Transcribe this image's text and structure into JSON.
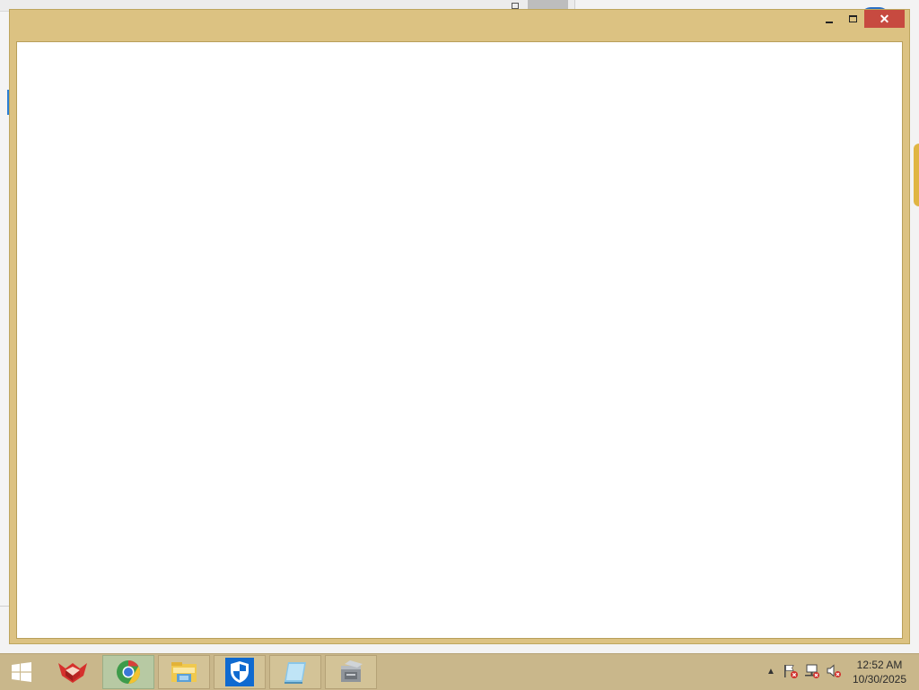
{
  "window": {
    "title": "",
    "buttons": {
      "minimize": "minimize",
      "maximize": "maximize",
      "close": "✕"
    }
  },
  "taskbar": {
    "apps": [
      {
        "name": "red-cube-app-icon",
        "active": false
      },
      {
        "name": "chrome-browser-icon",
        "active": true
      },
      {
        "name": "file-explorer-icon",
        "active": false
      },
      {
        "name": "windows-defender-icon",
        "active": false
      },
      {
        "name": "notepad-icon",
        "active": false
      },
      {
        "name": "archive-tool-icon",
        "active": false
      }
    ],
    "tray": {
      "chevron": "▲",
      "icons": [
        "action-center-flag-icon",
        "network-icon",
        "volume-muted-icon"
      ]
    },
    "clock": {
      "time": "12:52 AM",
      "date": "10/30/2025"
    }
  },
  "colors": {
    "window_border": "#dcc282",
    "taskbar": "#c9b78b",
    "close_button": "#c74a40"
  }
}
